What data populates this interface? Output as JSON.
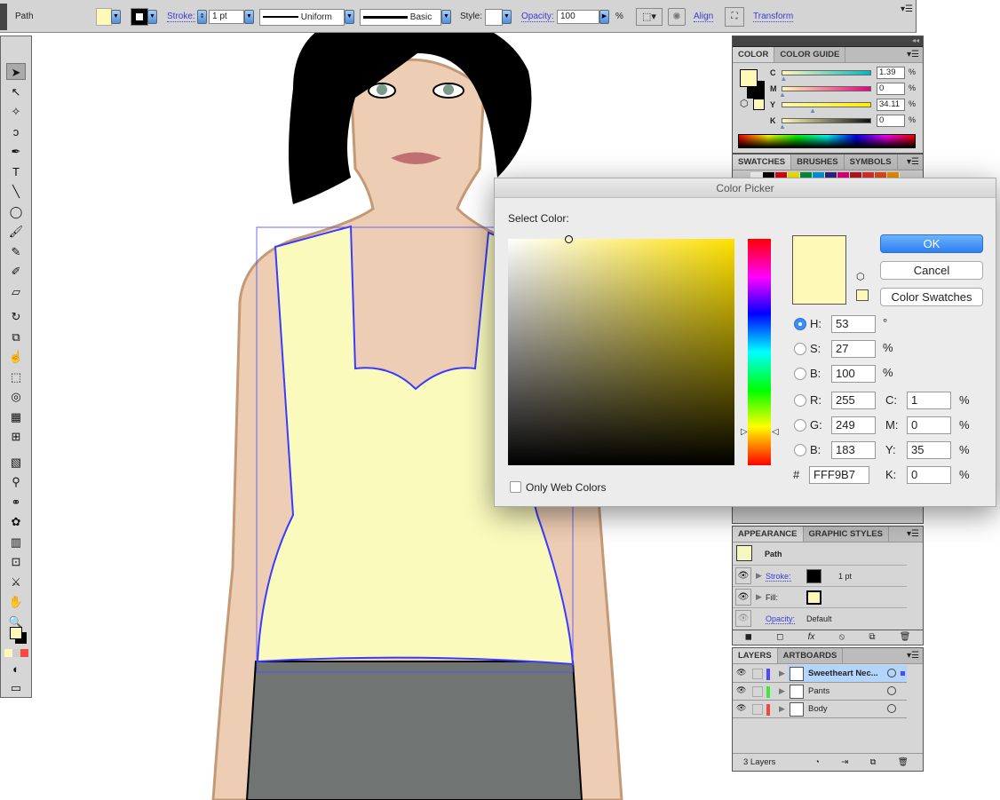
{
  "control_bar": {
    "object_type": "Path",
    "stroke_label": "Stroke:",
    "stroke_weight": "1 pt",
    "profile": "Uniform",
    "brush": "Basic",
    "style_label": "Style:",
    "opacity_label": "Opacity:",
    "opacity_value": "100",
    "opacity_unit": "%",
    "align_label": "Align",
    "transform_label": "Transform",
    "fill_color": "#FFF9B7",
    "stroke_color": "#000000"
  },
  "tools": [
    "selection-tool",
    "direct-selection-tool",
    "magic-wand-tool",
    "lasso-tool",
    "pen-tool",
    "type-tool",
    "line-tool",
    "ellipse-tool",
    "paintbrush-tool",
    "pencil-tool",
    "blob-brush-tool",
    "eraser-tool",
    "rotate-tool",
    "scale-tool",
    "warp-tool",
    "free-transform-tool",
    "shape-builder-tool",
    "perspective-grid-tool",
    "mesh-tool",
    "gradient-tool",
    "eyedropper-tool",
    "blend-tool",
    "symbol-sprayer-tool",
    "column-graph-tool",
    "artboard-tool",
    "slice-tool",
    "hand-tool",
    "zoom-tool"
  ],
  "color_panel": {
    "tabs": [
      "COLOR",
      "COLOR GUIDE"
    ],
    "channels": [
      {
        "label": "C",
        "value": "1.39",
        "pct": 1.39
      },
      {
        "label": "M",
        "value": "0",
        "pct": 0
      },
      {
        "label": "Y",
        "value": "34.11",
        "pct": 34.11
      },
      {
        "label": "K",
        "value": "0",
        "pct": 0
      }
    ],
    "unit": "%"
  },
  "swatches_panel": {
    "tabs": [
      "SWATCHES",
      "BRUSHES",
      "SYMBOLS"
    ],
    "swatches": [
      "#ffffff",
      "#000000",
      "#e30613",
      "#ffed00",
      "#009640",
      "#009fe3",
      "#312783",
      "#e6007e",
      "#be1622",
      "#e5332a",
      "#e94e1b",
      "#f39200"
    ]
  },
  "color_picker": {
    "title": "Color Picker",
    "select_label": "Select Color:",
    "ok": "OK",
    "cancel": "Cancel",
    "swatches_button": "Color Swatches",
    "only_web": "Only Web Colors",
    "hsb": [
      {
        "label": "H:",
        "value": "53",
        "unit": "°"
      },
      {
        "label": "S:",
        "value": "27",
        "unit": "%"
      },
      {
        "label": "B:",
        "value": "100",
        "unit": "%"
      }
    ],
    "rgb": [
      {
        "label": "R:",
        "value": "255"
      },
      {
        "label": "G:",
        "value": "249"
      },
      {
        "label": "B:",
        "value": "183"
      }
    ],
    "cmyk": [
      {
        "label": "C:",
        "value": "1",
        "unit": "%"
      },
      {
        "label": "M:",
        "value": "0",
        "unit": "%"
      },
      {
        "label": "Y:",
        "value": "35",
        "unit": "%"
      },
      {
        "label": "K:",
        "value": "0",
        "unit": "%"
      }
    ],
    "hex_label": "#",
    "hex": "FFF9B7",
    "hue_color": "#FFE100"
  },
  "appearance_panel": {
    "tabs": [
      "APPEARANCE",
      "GRAPHIC STYLES"
    ],
    "object": "Path",
    "stroke_label": "Stroke:",
    "stroke_value": "1 pt",
    "fill_label": "Fill:",
    "opacity_label": "Opacity:",
    "opacity_value": "Default"
  },
  "layers_panel": {
    "tabs": [
      "LAYERS",
      "ARTBOARDS"
    ],
    "layers": [
      {
        "name": "Sweetheart Nec...",
        "color": "#4a4aff",
        "selected": true
      },
      {
        "name": "Pants",
        "color": "#3ee63e",
        "selected": false
      },
      {
        "name": "Body",
        "color": "#f04848",
        "selected": false
      }
    ],
    "count": "3 Layers"
  }
}
